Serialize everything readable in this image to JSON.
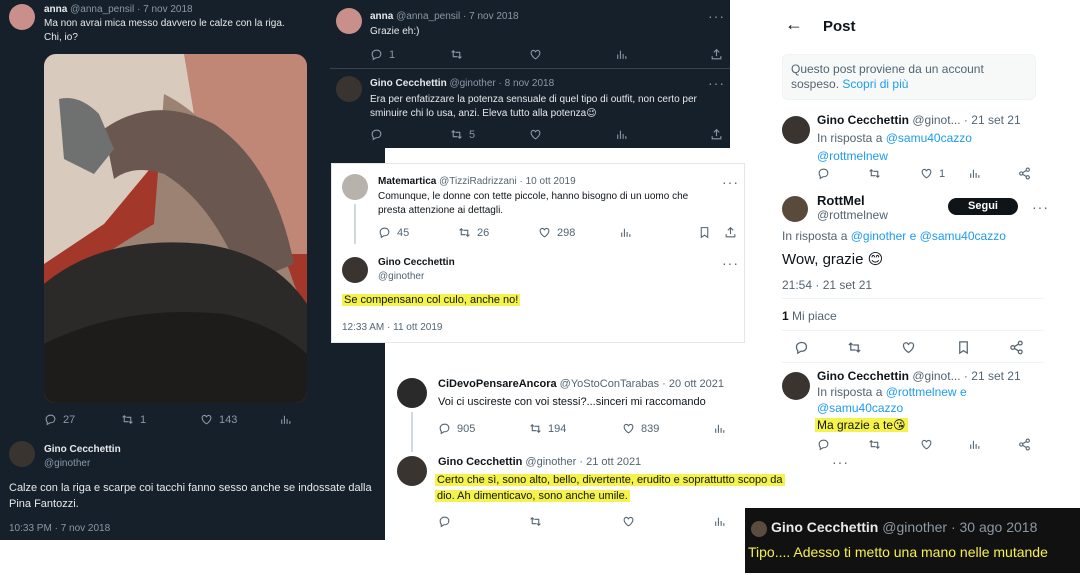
{
  "p1": {
    "name": "anna",
    "handle": "@anna_pensil",
    "date": "7 nov 2018",
    "text1": "Ma non avrai mica messo davvero le calze con la riga.",
    "text2": "Chi, io?",
    "replies": "27",
    "retweets": "1",
    "likes": "143",
    "reply_name": "Gino Cecchettin",
    "reply_handle": "@ginother",
    "reply_text": "Calze con la riga e scarpe coi tacchi fanno sesso anche se indossate dalla Pina Fantozzi.",
    "reply_time": "10:33 PM · 7 nov 2018"
  },
  "p2": {
    "name": "anna",
    "handle": "@anna_pensil",
    "date": "7 nov 2018",
    "text": "Grazie eh:)",
    "replies": "1",
    "reply_name": "Gino Cecchettin",
    "reply_handle": "@ginother",
    "reply_date": "8 nov 2018",
    "reply_text": "Era per enfatizzare la potenza sensuale di quel tipo di outfit, non certo per sminuire chi lo usa, anzi. Eleva tutto alla potenza😉",
    "reply_retweets": "5"
  },
  "p3": {
    "name": "Matemartica",
    "handle": "@TizziRadrizzani",
    "date": "10 ott 2019",
    "text": "Comunque, le donne con tette piccole, hanno bisogno di un uomo che presta attenzione ai dettagli.",
    "replies": "45",
    "retweets": "26",
    "likes": "298",
    "reply_name": "Gino Cecchettin",
    "reply_handle": "@ginother",
    "reply_text": "Se compensano col culo, anche no!",
    "reply_time": "12:33 AM · 11 ott 2019"
  },
  "p4": {
    "name": "CiDevoPensareAncora",
    "handle": "@YoStoConTarabas",
    "date": "20 ott 2021",
    "text": "Voi ci uscireste con voi stessi?...sinceri mi raccomando",
    "replies": "905",
    "retweets": "194",
    "likes": "839",
    "reply_name": "Gino Cecchettin",
    "reply_handle": "@ginother",
    "reply_date": "21 ott 2021",
    "reply_line1": "Certo che sì, sono alto, bello, divertente, erudito e soprattutto scopo da",
    "reply_line2": "dio. Ah dimenticavo, sono anche umile."
  },
  "p5": {
    "header_title": "Post",
    "notice": "Questo post proviene da un account sospeso.",
    "notice_link": "Scopri di più",
    "r1_name": "Gino Cecchettin",
    "r1_handle": "@ginot...",
    "r1_date": "21 set 21",
    "r1_inreply": "In risposta a",
    "r1_mention1": "@samu40cazzo",
    "r1_mention2": "@rottmelnew",
    "r1_likes": "1",
    "main_name": "RottMel",
    "main_handle": "@rottmelnew",
    "follow": "Segui",
    "main_inreply": "In risposta a",
    "main_mention1": "@ginother",
    "main_and": "e",
    "main_mention2": "@samu40cazzo",
    "main_text": "Wow, grazie 😊",
    "main_time": "21:54 · 21 set 21",
    "main_likes_count": "1",
    "main_likes_label": "Mi piace",
    "r2_name": "Gino Cecchettin",
    "r2_handle": "@ginot...",
    "r2_date": "21 set 21",
    "r2_inreply": "In risposta a",
    "r2_mention1": "@rottmelnew",
    "r2_and": "e",
    "r2_mention2": "@samu40cazzo",
    "r2_text": "Ma grazie a te😘"
  },
  "p6": {
    "name": "Gino Cecchettin",
    "handle": "@ginother",
    "date": "30 ago 2018",
    "text": "Tipo.... Adesso ti metto una mano nelle mutande"
  },
  "colors": {
    "dark_bg": "#15202b",
    "highlight": "#f5f24a",
    "link": "#1d9bf0"
  }
}
